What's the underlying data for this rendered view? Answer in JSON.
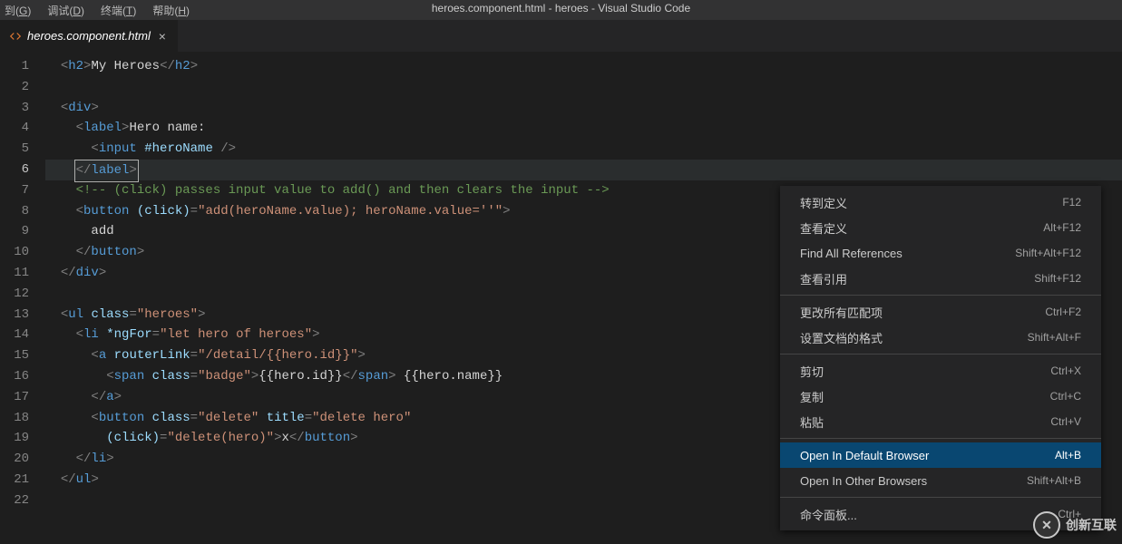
{
  "window": {
    "title": "heroes.component.html - heroes - Visual Studio Code"
  },
  "menubar": {
    "items": [
      {
        "pre": "到(",
        "key": "G",
        "post": ")"
      },
      {
        "pre": "调试(",
        "key": "D",
        "post": ")"
      },
      {
        "pre": "终端(",
        "key": "T",
        "post": ")"
      },
      {
        "pre": "帮助(",
        "key": "H",
        "post": ")"
      }
    ]
  },
  "tab": {
    "name": "heroes.component.html"
  },
  "gutter": {
    "lines": [
      "1",
      "2",
      "3",
      "4",
      "5",
      "6",
      "7",
      "8",
      "9",
      "10",
      "11",
      "12",
      "13",
      "14",
      "15",
      "16",
      "17",
      "18",
      "19",
      "20",
      "21",
      "22"
    ],
    "current": 6
  },
  "code": {
    "l1": {
      "tag_h2": "h2",
      "txt": "My Heroes"
    },
    "l3": {
      "tag_div": "div"
    },
    "l4": {
      "tag_label": "label",
      "txt": "Hero name:"
    },
    "l5": {
      "tag_input": "input",
      "attr": "#heroName"
    },
    "l6": {
      "tag_label": "label"
    },
    "l7": {
      "comment": "<!-- (click) passes input value to add() and then clears the input -->"
    },
    "l8": {
      "tag_button": "button",
      "attr": "(click)",
      "val": "\"add(heroName.value); heroName.value=''\""
    },
    "l9": {
      "txt": "add"
    },
    "l10": {
      "tag_button": "button"
    },
    "l11": {
      "tag_div": "div"
    },
    "l13": {
      "tag_ul": "ul",
      "attr": "class",
      "val": "\"heroes\""
    },
    "l14": {
      "tag_li": "li",
      "attr": "*ngFor",
      "val": "\"let hero of heroes\""
    },
    "l15": {
      "tag_a": "a",
      "attr": "routerLink",
      "val": "\"/detail/{{hero.id}}\""
    },
    "l16": {
      "tag_span": "span",
      "attr": "class",
      "val": "\"badge\"",
      "txt1": "{{hero.id}}",
      "txt2": " {{hero.name}}"
    },
    "l17": {
      "tag_a": "a"
    },
    "l18": {
      "tag_button": "button",
      "attr1": "class",
      "val1": "\"delete\"",
      "attr2": "title",
      "val2": "\"delete hero\""
    },
    "l19": {
      "attr": "(click)",
      "val": "\"delete(hero)\"",
      "txt": "x",
      "tag_button": "button"
    },
    "l20": {
      "tag_li": "li"
    },
    "l21": {
      "tag_ul": "ul"
    }
  },
  "context_menu": {
    "groups": [
      [
        {
          "label": "转到定义",
          "shortcut": "F12"
        },
        {
          "label": "查看定义",
          "shortcut": "Alt+F12"
        },
        {
          "label": "Find All References",
          "shortcut": "Shift+Alt+F12"
        },
        {
          "label": "查看引用",
          "shortcut": "Shift+F12"
        }
      ],
      [
        {
          "label": "更改所有匹配项",
          "shortcut": "Ctrl+F2"
        },
        {
          "label": "设置文档的格式",
          "shortcut": "Shift+Alt+F"
        }
      ],
      [
        {
          "label": "剪切",
          "shortcut": "Ctrl+X"
        },
        {
          "label": "复制",
          "shortcut": "Ctrl+C"
        },
        {
          "label": "粘贴",
          "shortcut": "Ctrl+V"
        }
      ],
      [
        {
          "label": "Open In Default Browser",
          "shortcut": "Alt+B",
          "selected": true
        },
        {
          "label": "Open In Other Browsers",
          "shortcut": "Shift+Alt+B"
        }
      ],
      [
        {
          "label": "命令面板...",
          "shortcut": "Ctrl+"
        }
      ]
    ]
  },
  "watermark": {
    "text": "创新互联"
  }
}
